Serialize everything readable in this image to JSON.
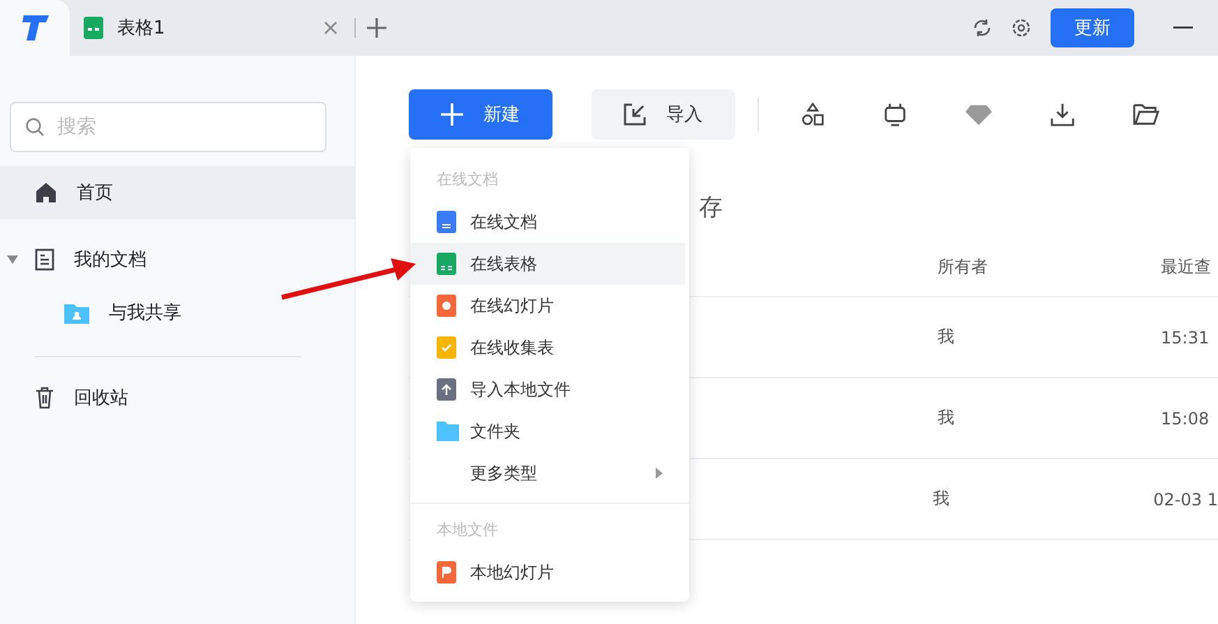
{
  "tabs": [
    {
      "label": "表格1",
      "selected": true
    }
  ],
  "titlebar": {
    "update_button": "更新"
  },
  "sidebar": {
    "search": {
      "placeholder": "搜索"
    },
    "items": [
      {
        "label": "首页",
        "kind": "home",
        "selected": true
      },
      {
        "label": "我的文档",
        "kind": "doc",
        "selected": false,
        "expanded": true,
        "children": [
          {
            "label": "与我共享",
            "selected": false
          }
        ]
      },
      {
        "label": "回收站",
        "kind": "trash",
        "selected": false
      }
    ]
  },
  "toolbar": {
    "new_button": "新建",
    "import_button": "导入"
  },
  "heading": "存",
  "table": {
    "columns": [
      "所有者",
      "最近查"
    ],
    "rows": [
      {
        "owner": "我",
        "time": "15:31"
      },
      {
        "owner": "我",
        "time": "15:08"
      },
      {
        "owner": "我",
        "time": "02-03 1"
      }
    ]
  },
  "new_menu": {
    "groups": [
      {
        "title": "在线文档",
        "items": [
          {
            "label": "在线文档",
            "kind": "doc",
            "selected": false
          },
          {
            "label": "在线表格",
            "kind": "sheet",
            "selected": true
          },
          {
            "label": "在线幻灯片",
            "kind": "slides",
            "selected": false
          },
          {
            "label": "在线收集表",
            "kind": "form",
            "selected": false
          },
          {
            "label": "导入本地文件",
            "kind": "upload",
            "selected": false
          },
          {
            "label": "文件夹",
            "kind": "folder",
            "selected": false
          },
          {
            "label": "更多类型",
            "kind": "more",
            "selected": false,
            "submenu": true
          }
        ]
      },
      {
        "title": "本地文件",
        "items": [
          {
            "label": "本地幻灯片",
            "kind": "ppt",
            "selected": false
          }
        ]
      }
    ]
  }
}
